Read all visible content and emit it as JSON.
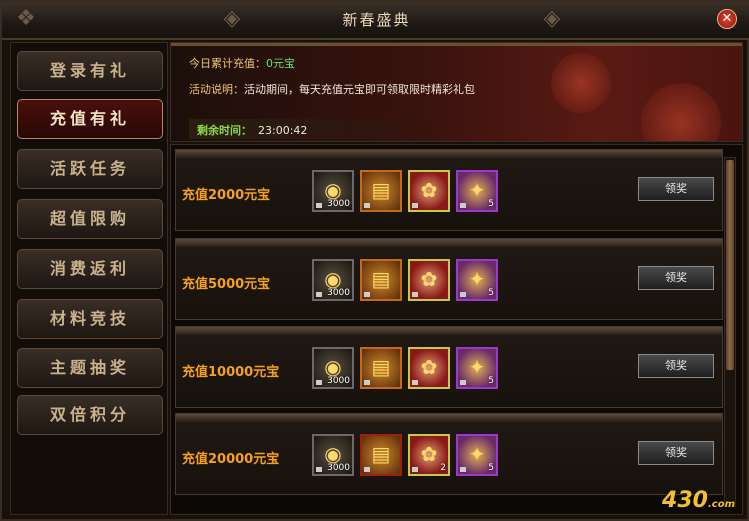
{
  "window": {
    "title": "新春盛典"
  },
  "sidebar": {
    "items": [
      {
        "label": "登录有礼",
        "active": false
      },
      {
        "label": "充值有礼",
        "active": true
      },
      {
        "label": "活跃任务",
        "active": false
      },
      {
        "label": "超值限购",
        "active": false
      },
      {
        "label": "消费返利",
        "active": false
      },
      {
        "label": "材料竞技",
        "active": false
      },
      {
        "label": "主题抽奖",
        "active": false
      },
      {
        "label": "双倍积分",
        "active": false
      }
    ]
  },
  "banner": {
    "total_label": "今日累计充值：",
    "total_value": "0元宝",
    "desc_label": "活动说明：",
    "desc_text": "活动期间，每天充值元宝即可领取限时精彩礼包",
    "time_label": "剩余时间：",
    "time_value": "23:00:42"
  },
  "rewards": [
    {
      "label": "充值2000元宝",
      "items": [
        {
          "icon": "gold-ingot-icon",
          "count": "3000"
        },
        {
          "icon": "scroll-icon",
          "count": ""
        },
        {
          "icon": "red-pouch-icon",
          "count": ""
        },
        {
          "icon": "gold-tag-icon",
          "count": "5"
        }
      ],
      "button": "领奖"
    },
    {
      "label": "充值5000元宝",
      "items": [
        {
          "icon": "gold-ingot-icon",
          "count": "3000"
        },
        {
          "icon": "scroll-icon",
          "count": ""
        },
        {
          "icon": "red-pouch-icon",
          "count": ""
        },
        {
          "icon": "gold-tag-icon",
          "count": "5"
        }
      ],
      "button": "领奖"
    },
    {
      "label": "充值10000元宝",
      "items": [
        {
          "icon": "gold-ingot-icon",
          "count": "3000"
        },
        {
          "icon": "scroll-icon",
          "count": ""
        },
        {
          "icon": "red-pouch-icon",
          "count": ""
        },
        {
          "icon": "gold-tag-icon",
          "count": "5"
        }
      ],
      "button": "领奖"
    },
    {
      "label": "充值20000元宝",
      "items": [
        {
          "icon": "gold-ingot-icon",
          "count": "3000"
        },
        {
          "icon": "red-scroll-icon",
          "count": ""
        },
        {
          "icon": "red-pouch-icon",
          "count": "2"
        },
        {
          "icon": "gold-tag-icon",
          "count": "5"
        }
      ],
      "button": "领奖"
    }
  ],
  "watermark": {
    "text": "430",
    "suffix": ".com"
  }
}
